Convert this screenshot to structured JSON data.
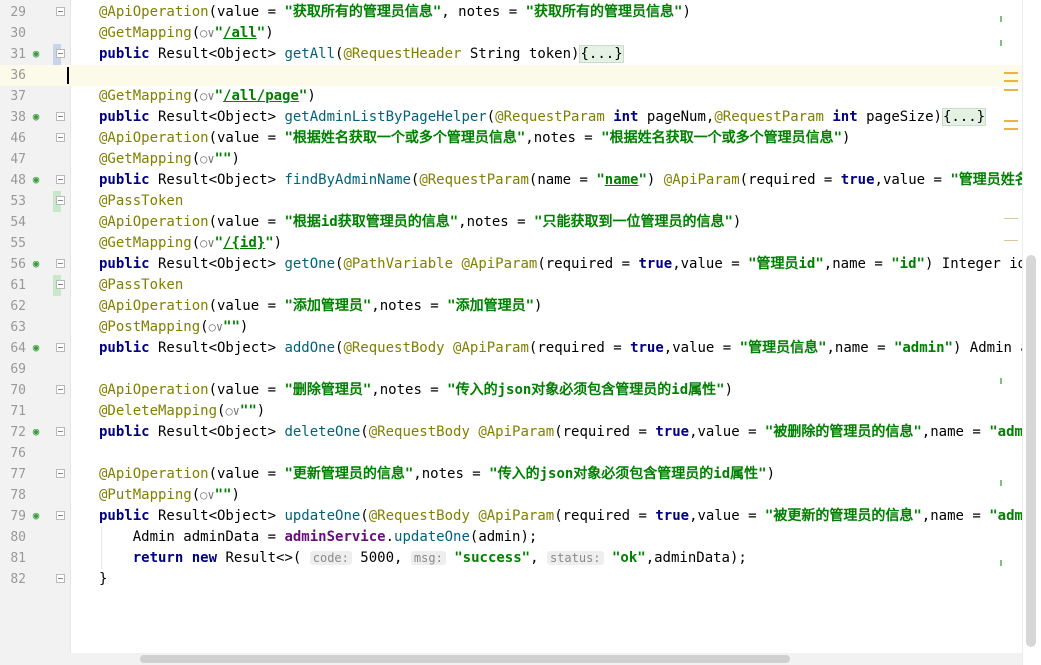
{
  "editor": {
    "lines": [
      {
        "num": "29",
        "code": "@ApiOperation(value = \"获取所有的管理员信息\", notes = \"获取所有的管理员信息\")"
      },
      {
        "num": "30",
        "code": "@GetMapping(○∨\"/all\")"
      },
      {
        "num": "31",
        "code": "public Result<Object> getAll(@RequestHeader String token){...}"
      },
      {
        "num": "36",
        "code": ""
      },
      {
        "num": "37",
        "code": "@GetMapping(○∨\"/all/page\")"
      },
      {
        "num": "38",
        "code": "public Result<Object> getAdminListByPageHelper(@RequestParam int pageNum,@RequestParam int pageSize){...}"
      },
      {
        "num": "46",
        "code": "@ApiOperation(value = \"根据姓名获取一个或多个管理员信息\",notes = \"根据姓名获取一个或多个管理员信息\")"
      },
      {
        "num": "47",
        "code": "@GetMapping(○∨\"\")"
      },
      {
        "num": "48",
        "code": "public Result<Object> findByAdminName(@RequestParam(name = \"name\") @ApiParam(required = true,value = \"管理员姓名\",nam"
      },
      {
        "num": "53",
        "code": "@PassToken"
      },
      {
        "num": "54",
        "code": "@ApiOperation(value = \"根据id获取管理员的信息\",notes = \"只能获取到一位管理员的信息\")"
      },
      {
        "num": "55",
        "code": "@GetMapping(○∨\"/{id}\")"
      },
      {
        "num": "56",
        "code": "public Result<Object> getOne(@PathVariable @ApiParam(required = true,value = \"管理员id\",name = \"id\") Integer id){..."
      },
      {
        "num": "61",
        "code": "@PassToken"
      },
      {
        "num": "62",
        "code": "@ApiOperation(value = \"添加管理员\",notes = \"添加管理员\")"
      },
      {
        "num": "63",
        "code": "@PostMapping(○∨\"\")"
      },
      {
        "num": "64",
        "code": "public Result<Object> addOne(@RequestBody @ApiParam(required = true,value = \"管理员信息\",name = \"admin\") Admin admin"
      },
      {
        "num": "69",
        "code": ""
      },
      {
        "num": "70",
        "code": "@ApiOperation(value = \"删除管理员\",notes = \"传入的json对象必须包含管理员的id属性\")"
      },
      {
        "num": "71",
        "code": "@DeleteMapping(○∨\"\")"
      },
      {
        "num": "72",
        "code": "public Result<Object> deleteOne(@RequestBody @ApiParam(required = true,value = \"被删除的管理员的信息\",name = \"admin\")"
      },
      {
        "num": "76",
        "code": ""
      },
      {
        "num": "77",
        "code": "@ApiOperation(value = \"更新管理员的信息\",notes = \"传入的json对象必须包含管理员的id属性\")"
      },
      {
        "num": "78",
        "code": "@PutMapping(○∨\"\")"
      },
      {
        "num": "79",
        "code": "public Result<Object> updateOne(@RequestBody @ApiParam(required = true,value = \"被更新的管理员的信息\",name = \"admin\")"
      },
      {
        "num": "80",
        "code": "    Admin adminData = adminService.updateOne(admin);"
      },
      {
        "num": "81",
        "code": "    return new Result<>( code: 5000, msg: \"success\", status: \"ok\",adminData);"
      },
      {
        "num": "82",
        "code": "}"
      }
    ],
    "hints": {
      "code": "code:",
      "msg": "msg:",
      "status": "status:"
    }
  }
}
